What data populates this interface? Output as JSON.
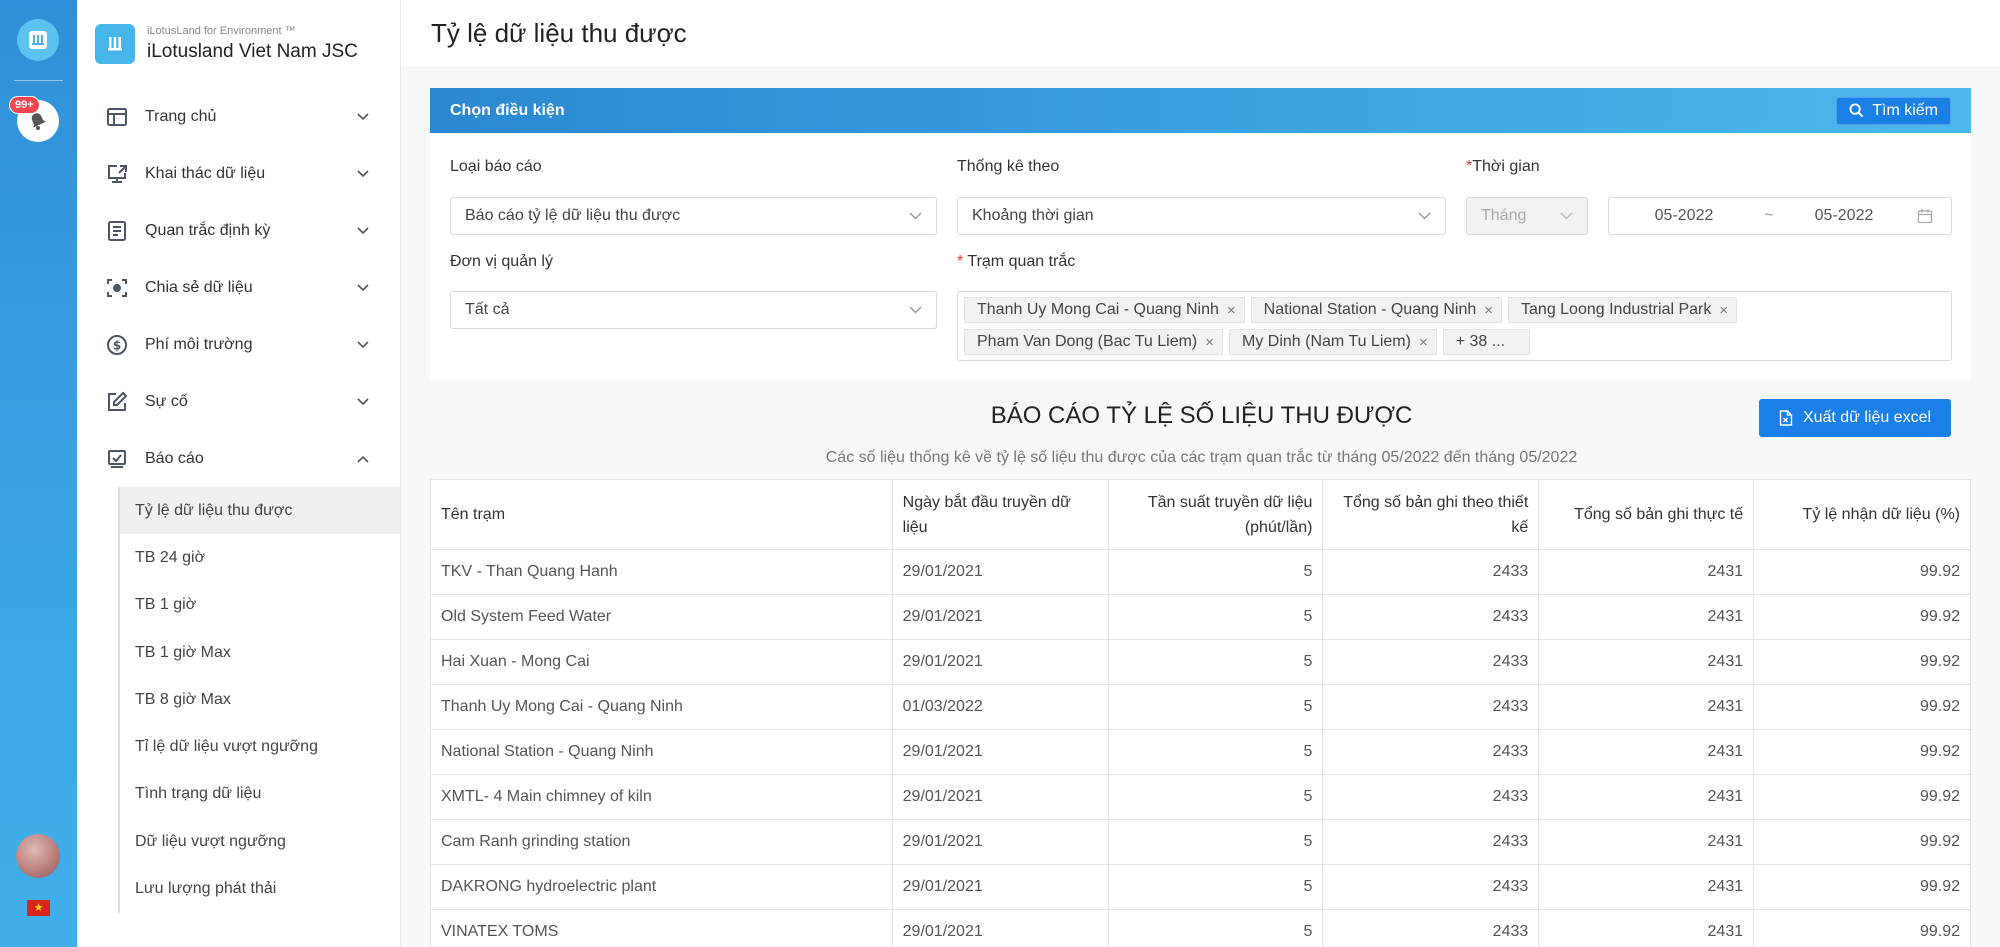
{
  "rail": {
    "badge": "99+"
  },
  "brand": {
    "subtitle": "iLotusLand for Environment ™",
    "name": "iLotusland Viet Nam JSC"
  },
  "menu": [
    {
      "label": "Trang chủ",
      "icon": "layout-icon"
    },
    {
      "label": "Khai thác dữ liệu",
      "icon": "monitor-share-icon"
    },
    {
      "label": "Quan trắc định kỳ",
      "icon": "document-list-icon"
    },
    {
      "label": "Chia sẻ dữ liệu",
      "icon": "focus-icon"
    },
    {
      "label": "Phí môi trường",
      "icon": "dollar-icon"
    },
    {
      "label": "Sự cố",
      "icon": "edit-icon"
    },
    {
      "label": "Báo cáo",
      "icon": "report-icon"
    }
  ],
  "submenu": [
    "Tỷ lệ dữ liệu thu được",
    "TB 24 giờ",
    "TB 1 giờ",
    "TB 1 giờ Max",
    "TB 8 giờ Max",
    "Tỉ lệ dữ liệu vượt ngưỡng",
    "Tình trạng dữ liệu",
    "Dữ liệu vượt ngưỡng",
    "Lưu lượng phát thải"
  ],
  "page": {
    "title": "Tỷ lệ dữ liệu thu được"
  },
  "filter": {
    "title": "Chọn điều kiện",
    "search": "Tìm kiếm",
    "report_type_label": "Loại báo cáo",
    "report_type_value": "Báo cáo tỷ lệ dữ liệu thu được",
    "stat_by_label": "Thống kê theo",
    "stat_by_value": "Khoảng thời gian",
    "time_label": "Thời gian",
    "time_unit": "Tháng",
    "date_from": "05-2022",
    "date_sep": "~",
    "date_to": "05-2022",
    "unit_label": "Đơn vị quản lý",
    "unit_value": "Tất cả",
    "station_label": "Trạm quan trắc",
    "stations": [
      "Thanh Uy Mong Cai - Quang Ninh",
      "National Station - Quang Ninh",
      "Tang Loong Industrial Park",
      "Pham Van Dong (Bac Tu Liem)",
      "My Dinh (Nam Tu Liem)"
    ],
    "more": "+ 38 ..."
  },
  "report": {
    "title": "BÁO CÁO TỶ LỆ SỐ LIỆU THU ĐƯỢC",
    "export": "Xuất dữ liệu excel",
    "subtitle": "Các số liệu thống kê về tỷ lệ số liệu thu được của các trạm quan trắc từ tháng 05/2022 đến tháng 05/2022",
    "columns": [
      "Tên trạm",
      "Ngày bắt đầu truyền dữ liệu",
      "Tần suất truyền dữ liệu (phút/lần)",
      "Tổng số bản ghi theo thiết kế",
      "Tổng số bản ghi thực tế",
      "Tỷ lệ nhận dữ liệu (%)"
    ],
    "rows": [
      [
        "TKV - Than Quang Hanh",
        "29/01/2021",
        "5",
        "2433",
        "2431",
        "99.92"
      ],
      [
        "Old System Feed Water",
        "29/01/2021",
        "5",
        "2433",
        "2431",
        "99.92"
      ],
      [
        "Hai Xuan - Mong Cai",
        "29/01/2021",
        "5",
        "2433",
        "2431",
        "99.92"
      ],
      [
        "Thanh Uy Mong Cai - Quang Ninh",
        "01/03/2022",
        "5",
        "2433",
        "2431",
        "99.92"
      ],
      [
        "National Station - Quang Ninh",
        "29/01/2021",
        "5",
        "2433",
        "2431",
        "99.92"
      ],
      [
        "XMTL- 4 Main chimney of kiln",
        "29/01/2021",
        "5",
        "2433",
        "2431",
        "99.92"
      ],
      [
        "Cam Ranh grinding station",
        "29/01/2021",
        "5",
        "2433",
        "2431",
        "99.92"
      ],
      [
        "DAKRONG hydroelectric plant",
        "29/01/2021",
        "5",
        "2433",
        "2431",
        "99.92"
      ],
      [
        "VINATEX TOMS",
        "29/01/2021",
        "5",
        "2433",
        "2431",
        "99.92"
      ]
    ]
  }
}
